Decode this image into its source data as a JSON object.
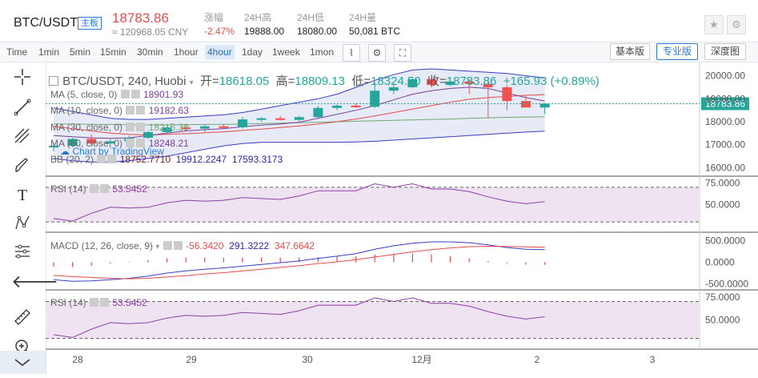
{
  "header": {
    "pair": "BTC/USDT",
    "badge": "主板",
    "price": "18783.86",
    "cny": "≈ 120968.05 CNY",
    "stats": [
      {
        "label": "涨幅",
        "value": "-2.47%"
      },
      {
        "label": "24H高",
        "value": "19888.00"
      },
      {
        "label": "24H低",
        "value": "18080.00"
      },
      {
        "label": "24H量",
        "value": "50,081 BTC"
      }
    ],
    "star_icon": "star-icon",
    "settings_icon": "gear-icon"
  },
  "timeframes": [
    "Time",
    "1min",
    "5min",
    "15min",
    "30min",
    "1hour",
    "4hour",
    "1day",
    "1week",
    "1mon"
  ],
  "active_timeframe": "4hour",
  "modes": [
    "基本版",
    "专业版",
    "深度图"
  ],
  "active_mode": "专业版",
  "left_tools": [
    "crosshair-icon",
    "trend-line-icon",
    "fib-icon",
    "brush-icon",
    "text-icon",
    "pattern-icon",
    "levels-icon",
    "back-arrow-icon",
    "ruler-icon",
    "zoom-in-icon",
    "collapse-icon"
  ],
  "legend": {
    "title": "BTC/USDT, 240, Huobi",
    "open_label": "开=",
    "open": "18618.05",
    "high_label": "高=",
    "high": "18809.13",
    "low_label": "低=",
    "low": "18324.50",
    "close_label": "收=",
    "close": "18783.86",
    "change": "+165.93 (+0.89%)",
    "ma5": {
      "name": "MA (5, close, 0)",
      "value": "18901.93"
    },
    "ma10": {
      "name": "MA (10, close, 0)",
      "value": "19182.63"
    },
    "ma30": {
      "name": "MA (30, close, 0)",
      "value": "18215.39"
    },
    "ma60": {
      "name": "MA (60, close, 0)",
      "value": "18248.21"
    },
    "bb": {
      "name": "BB (20, 2)",
      "v1": "18752.7710",
      "v2": "19912.2247",
      "v3": "17593.3173"
    },
    "rsi": {
      "name": "RSI (14)",
      "value": "53.5452"
    },
    "macd": {
      "name": "MACD (12, 26, close, 9)",
      "v1": "-56.3420",
      "v2": "291.3222",
      "v3": "347.6642"
    },
    "rsi2": {
      "name": "RSI (14)",
      "value": "53.5452"
    },
    "watermark": "Chart by TradingView"
  },
  "colors": {
    "up": "#26a69a",
    "down": "#ef5350",
    "ma5": "#7a3f9a",
    "ma10": "#e44b4b",
    "ma30": "#6fa86f",
    "bb": "#3a3dc4",
    "macd": "#3a3dc4",
    "signal": "#e44b4b",
    "rsi": "#8e3fa3"
  },
  "chart_data": [
    {
      "type": "candlestick",
      "title": "BTC/USDT, 240, Huobi",
      "x_tick_labels": [
        "28",
        "29",
        "30",
        "12月",
        "2",
        "3"
      ],
      "y_tick_labels": [
        "20000.00",
        "19000.00",
        "18000.00",
        "17000.00",
        "16000.00"
      ],
      "ylim": [
        15700,
        20300
      ],
      "last_price_label": "18783.86",
      "candles": [
        {
          "o": 16900,
          "h": 17100,
          "l": 16700,
          "c": 16950
        },
        {
          "o": 16950,
          "h": 17300,
          "l": 16900,
          "c": 17250
        },
        {
          "o": 17250,
          "h": 17450,
          "l": 17000,
          "c": 17050
        },
        {
          "o": 17050,
          "h": 17250,
          "l": 16950,
          "c": 17150
        },
        {
          "o": 17150,
          "h": 17400,
          "l": 17050,
          "c": 17300
        },
        {
          "o": 17300,
          "h": 17600,
          "l": 17250,
          "c": 17550
        },
        {
          "o": 17550,
          "h": 17800,
          "l": 17500,
          "c": 17750
        },
        {
          "o": 17750,
          "h": 17900,
          "l": 17600,
          "c": 17700
        },
        {
          "o": 17700,
          "h": 17900,
          "l": 17550,
          "c": 17800
        },
        {
          "o": 17800,
          "h": 17900,
          "l": 17700,
          "c": 17760
        },
        {
          "o": 17760,
          "h": 18200,
          "l": 17700,
          "c": 18100
        },
        {
          "o": 18100,
          "h": 18200,
          "l": 18000,
          "c": 18150
        },
        {
          "o": 18150,
          "h": 18250,
          "l": 18050,
          "c": 18080
        },
        {
          "o": 18080,
          "h": 18250,
          "l": 18000,
          "c": 18200
        },
        {
          "o": 18200,
          "h": 18700,
          "l": 18150,
          "c": 18600
        },
        {
          "o": 18600,
          "h": 18750,
          "l": 18500,
          "c": 18700
        },
        {
          "o": 18700,
          "h": 18800,
          "l": 18600,
          "c": 18650
        },
        {
          "o": 18650,
          "h": 19700,
          "l": 18600,
          "c": 19350
        },
        {
          "o": 19350,
          "h": 19650,
          "l": 19200,
          "c": 19500
        },
        {
          "o": 19500,
          "h": 19900,
          "l": 19450,
          "c": 19850
        },
        {
          "o": 19850,
          "h": 19900,
          "l": 19500,
          "c": 19600
        },
        {
          "o": 19600,
          "h": 19800,
          "l": 19550,
          "c": 19750
        },
        {
          "o": 19750,
          "h": 19850,
          "l": 19200,
          "c": 19650
        },
        {
          "o": 19650,
          "h": 19750,
          "l": 18150,
          "c": 19500
        },
        {
          "o": 19500,
          "h": 19600,
          "l": 18500,
          "c": 18900
        },
        {
          "o": 18900,
          "h": 19150,
          "l": 18700,
          "c": 18620
        },
        {
          "o": 18618,
          "h": 18809,
          "l": 18324,
          "c": 18783
        }
      ],
      "series": [
        {
          "name": "MA (5, close, 0)",
          "values": [
            17400,
            17350,
            17300,
            17280,
            17300,
            17400,
            17500,
            17600,
            17650,
            17700,
            17780,
            17850,
            17900,
            17980,
            18150,
            18320,
            18500,
            18700,
            18950,
            19200,
            19350,
            19450,
            19500,
            19450,
            19250,
            19050,
            18901
          ]
        },
        {
          "name": "MA (10, close, 0)",
          "values": [
            17800,
            17700,
            17600,
            17500,
            17450,
            17420,
            17450,
            17480,
            17520,
            17560,
            17620,
            17680,
            17750,
            17820,
            17900,
            18000,
            18120,
            18250,
            18400,
            18550,
            18700,
            18850,
            18980,
            19050,
            19100,
            19150,
            19182
          ]
        },
        {
          "name": "MA (30, close, 0)",
          "values": [
            17900,
            17900,
            17890,
            17880,
            17870,
            17860,
            17860,
            17870,
            17880,
            17890,
            17900,
            17920,
            17940,
            17960,
            17980,
            18000,
            18020,
            18040,
            18060,
            18080,
            18100,
            18120,
            18150,
            18170,
            18190,
            18205,
            18215
          ]
        },
        {
          "name": "BB upper",
          "values": [
            18600,
            18450,
            18300,
            18150,
            18100,
            18100,
            18150,
            18200,
            18250,
            18300,
            18400,
            18550,
            18700,
            18850,
            19000,
            19200,
            19500,
            19800,
            20050,
            20250,
            20300,
            20250,
            20200,
            20150,
            20100,
            20000,
            19912
          ]
        },
        {
          "name": "BB lower",
          "values": [
            16400,
            16300,
            16250,
            16250,
            16300,
            16400,
            16500,
            16650,
            16800,
            16950,
            17050,
            17100,
            17100,
            17100,
            17100,
            17100,
            17120,
            17150,
            17200,
            17250,
            17300,
            17350,
            17400,
            17450,
            17500,
            17550,
            17593
          ]
        }
      ]
    },
    {
      "type": "line",
      "title": "RSI (14)",
      "y_tick_labels": [
        "75.0000",
        "50.0000"
      ],
      "ylim": [
        20,
        80
      ],
      "series": [
        {
          "name": "RSI (14)",
          "values": [
            34,
            31,
            40,
            47,
            46,
            47,
            52,
            55,
            54,
            55,
            58,
            57,
            56,
            60,
            66,
            66,
            66,
            74,
            70,
            74,
            68,
            68,
            65,
            59,
            54,
            51,
            53.5
          ]
        }
      ]
    },
    {
      "type": "line",
      "title": "MACD (12, 26, close, 9)",
      "y_tick_labels": [
        "500.0000",
        "0.0000",
        "-500.0000"
      ],
      "ylim": [
        -600,
        600
      ],
      "series": [
        {
          "name": "MACD",
          "values": [
            -400,
            -440,
            -430,
            -400,
            -370,
            -320,
            -250,
            -200,
            -160,
            -130,
            -90,
            -50,
            -10,
            30,
            90,
            140,
            200,
            300,
            380,
            440,
            470,
            470,
            450,
            400,
            340,
            300,
            291
          ]
        },
        {
          "name": "Signal",
          "values": [
            -300,
            -330,
            -350,
            -370,
            -380,
            -370,
            -340,
            -310,
            -270,
            -240,
            -200,
            -160,
            -120,
            -80,
            -30,
            10,
            60,
            120,
            180,
            240,
            290,
            330,
            360,
            370,
            365,
            355,
            347
          ]
        },
        {
          "name": "Histogram",
          "values": [
            -100,
            -110,
            -80,
            -30,
            10,
            50,
            90,
            110,
            110,
            110,
            110,
            110,
            110,
            110,
            120,
            130,
            140,
            180,
            200,
            200,
            180,
            140,
            90,
            30,
            -25,
            -55,
            -56
          ]
        }
      ]
    },
    {
      "type": "line",
      "title": "RSI (14)",
      "y_tick_labels": [
        "75.0000",
        "50.0000"
      ],
      "ylim": [
        20,
        80
      ],
      "series": [
        {
          "name": "RSI (14)",
          "values": [
            34,
            31,
            40,
            47,
            46,
            47,
            52,
            55,
            54,
            55,
            58,
            57,
            56,
            60,
            66,
            66,
            66,
            74,
            70,
            74,
            68,
            68,
            65,
            59,
            54,
            51,
            53.5
          ]
        }
      ]
    }
  ]
}
